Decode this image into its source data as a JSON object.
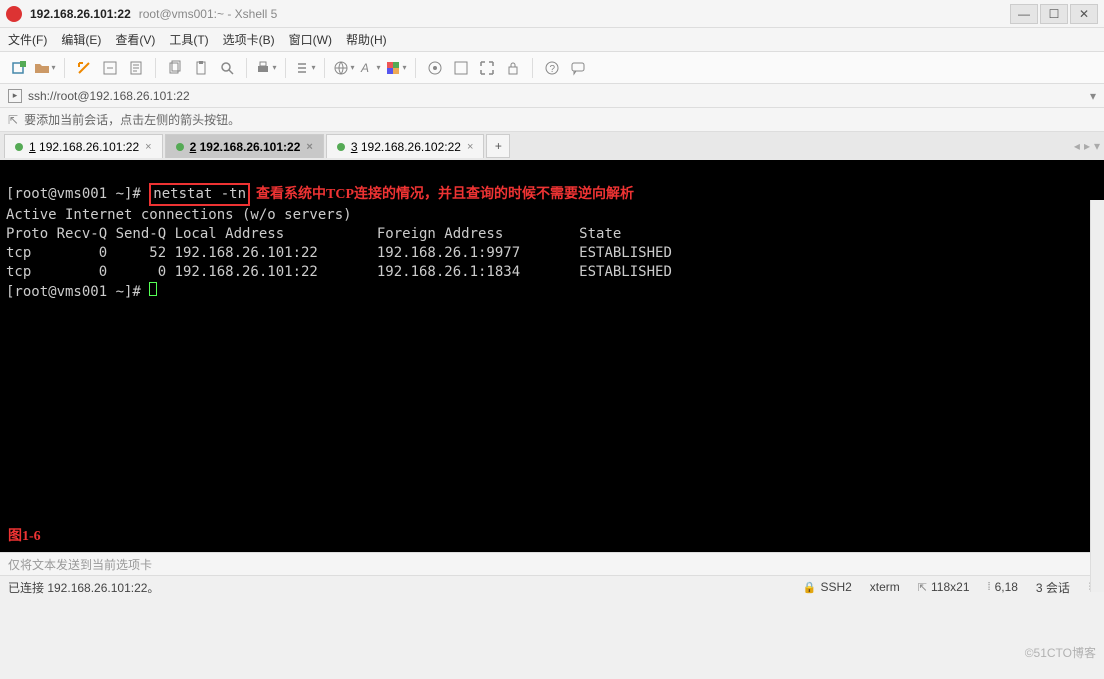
{
  "title": {
    "host": "192.168.26.101:22",
    "sub": "root@vms001:~ - Xshell 5"
  },
  "menus": {
    "file": "文件(F)",
    "edit": "编辑(E)",
    "view": "查看(V)",
    "tools": "工具(T)",
    "tabs": "选项卡(B)",
    "window": "窗口(W)",
    "help": "帮助(H)"
  },
  "address": {
    "url": "ssh://root@192.168.26.101:22"
  },
  "infobar": {
    "text": "要添加当前会话，点击左侧的箭头按钮。"
  },
  "tabs": [
    {
      "num": "1",
      "label": "192.168.26.101:22",
      "active": false
    },
    {
      "num": "2",
      "label": "192.168.26.101:22",
      "active": true
    },
    {
      "num": "3",
      "label": "192.168.26.102:22",
      "active": false
    }
  ],
  "terminal": {
    "prompt1": "[root@vms001 ~]# ",
    "cmd": "netstat -tn",
    "annotation": "查看系统中TCP连接的情况，并且查询的时候不需要逆向解析",
    "line_active": "Active Internet connections (w/o servers)",
    "header": "Proto Recv-Q Send-Q Local Address           Foreign Address         State",
    "rows": [
      "tcp        0     52 192.168.26.101:22       192.168.26.1:9977       ESTABLISHED",
      "tcp        0      0 192.168.26.101:22       192.168.26.1:1834       ESTABLISHED"
    ],
    "prompt2": "[root@vms001 ~]# ",
    "figure": "图1-6"
  },
  "inputbar": {
    "placeholder": "仅将文本发送到当前选项卡"
  },
  "status": {
    "conn": "已连接 192.168.26.101:22。",
    "ssh": "SSH2",
    "term": "xterm",
    "size": "118x21",
    "cursor": "6,18",
    "sessions_label": "3 会话"
  },
  "watermark": "©51CTO博客"
}
